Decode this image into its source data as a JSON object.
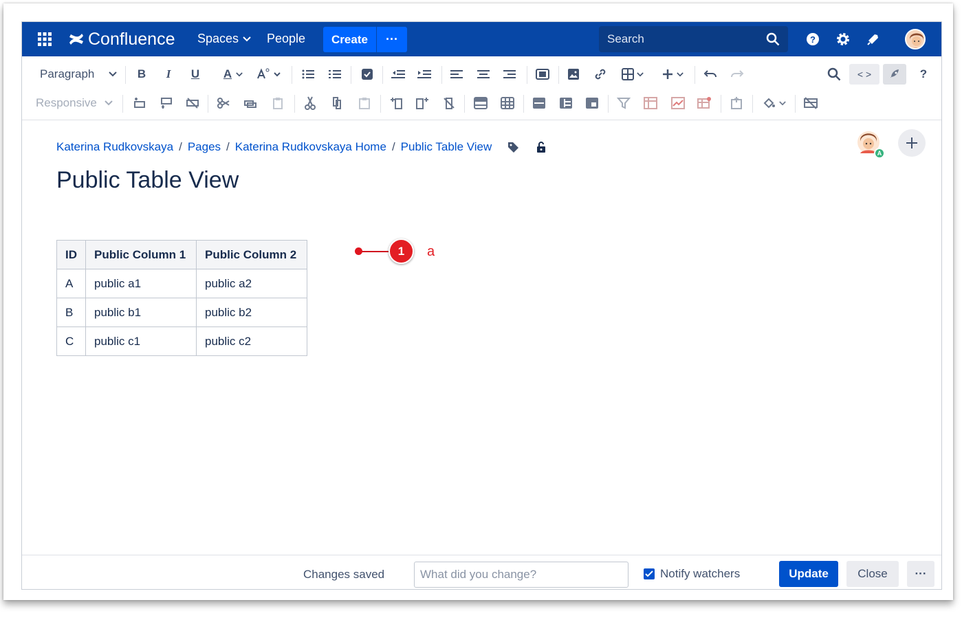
{
  "nav": {
    "app_name": "Confluence",
    "spaces": "Spaces",
    "people": "People",
    "create": "Create",
    "create_more": "···",
    "search_placeholder": "Search"
  },
  "toolbar": {
    "paragraph": "Paragraph",
    "bold": "B",
    "italic": "I",
    "underline": "U",
    "text_color": "A",
    "code": "< >",
    "help": "?",
    "responsive": "Responsive"
  },
  "breadcrumb": [
    "Katerina Rudkovskaya",
    "Pages",
    "Katerina Rudkovskaya Home",
    "Public Table View"
  ],
  "page": {
    "title": "Public Table View",
    "avatar_badge": "A"
  },
  "table": {
    "headers": [
      "ID",
      "Public Column 1",
      "Public Column 2"
    ],
    "rows": [
      [
        "A",
        "public a1",
        "public a2"
      ],
      [
        "B",
        "public b1",
        "public b2"
      ],
      [
        "C",
        "public c1",
        "public c2"
      ]
    ]
  },
  "annotation": {
    "number": "1",
    "label": "a"
  },
  "footer": {
    "status": "Changes saved",
    "change_placeholder": "What did you change?",
    "notify": "Notify watchers",
    "update": "Update",
    "close": "Close",
    "more": "···"
  },
  "colors": {
    "nav_bg": "#0747a6",
    "primary": "#0052cc",
    "annotation": "#e31e24"
  }
}
